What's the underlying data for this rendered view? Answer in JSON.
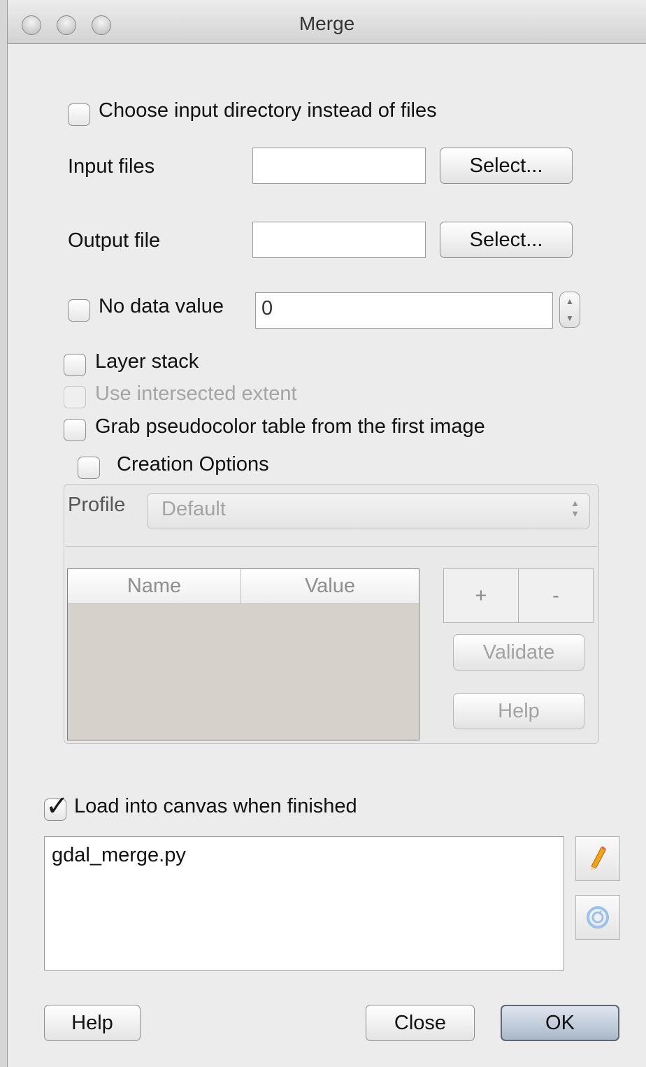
{
  "window": {
    "title": "Merge"
  },
  "options": {
    "choose_dir": {
      "label": "Choose input directory instead of files",
      "checked": false
    },
    "input_files": {
      "label": "Input files",
      "value": "",
      "button": "Select..."
    },
    "output_file": {
      "label": "Output file",
      "value": "",
      "button": "Select..."
    },
    "no_data": {
      "label": "No data value",
      "value": "0",
      "checked": false
    },
    "layer_stack": {
      "label": "Layer stack",
      "checked": false
    },
    "intersected": {
      "label": "Use intersected extent",
      "checked": false,
      "enabled": false
    },
    "pseudocolor": {
      "label": "Grab pseudocolor table from the first image",
      "checked": false
    },
    "creation_options": {
      "label": "Creation Options",
      "checked": false
    }
  },
  "creation": {
    "profile_label": "Profile",
    "profile_value": "Default",
    "columns": [
      "Name",
      "Value"
    ],
    "add_label": "+",
    "remove_label": "-",
    "validate_label": "Validate",
    "help_label": "Help"
  },
  "load_canvas": {
    "label": "Load into canvas when finished",
    "checked": true
  },
  "command": {
    "text": "gdal_merge.py"
  },
  "icons": {
    "edit": "pencil-icon",
    "reset": "refresh-icon"
  },
  "footer": {
    "help": "Help",
    "close": "Close",
    "ok": "OK"
  }
}
